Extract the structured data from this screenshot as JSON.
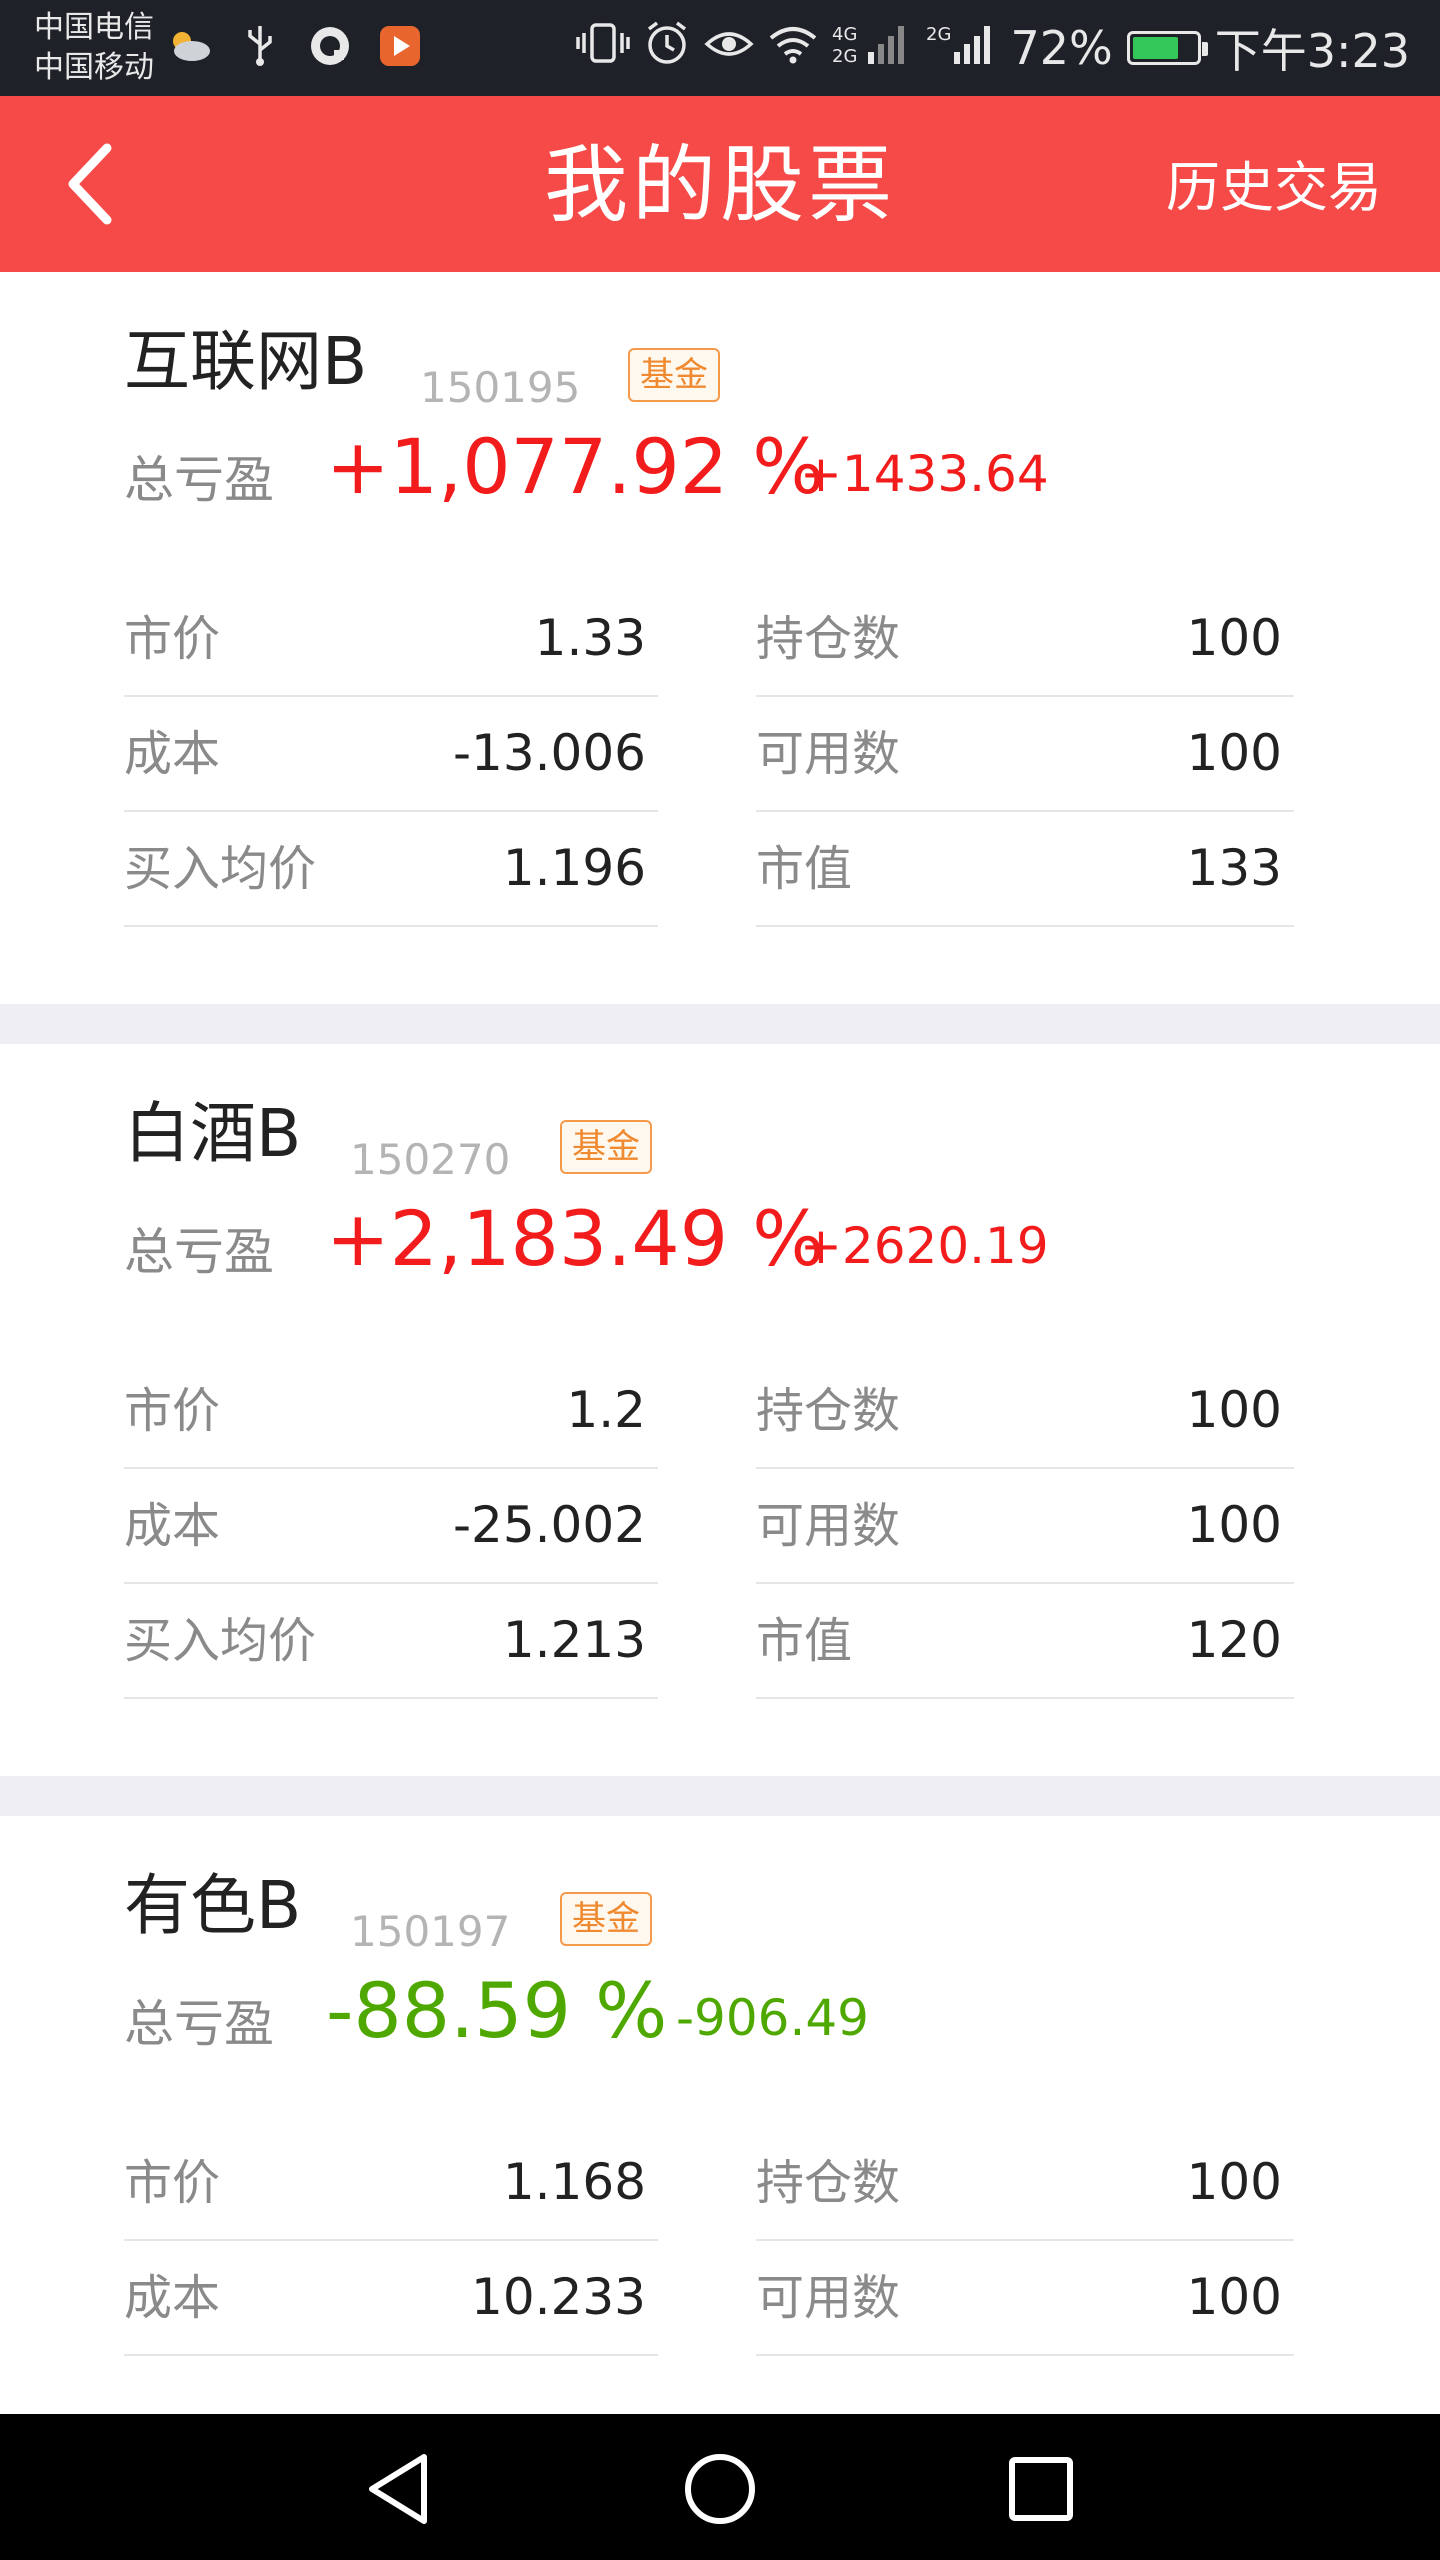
{
  "status_bar": {
    "carrier_1": "中国电信",
    "carrier_2": "中国移动",
    "battery_percent": "72%",
    "battery_level": 0.72,
    "time": "下午3:23",
    "icons": [
      "cloud-icon",
      "usb-icon",
      "qq-icon",
      "play-app-icon",
      "vibrate-icon",
      "alarm-icon",
      "eye-icon",
      "wifi-icon",
      "signal-4g-icon",
      "signal-2g-icon",
      "battery-icon"
    ]
  },
  "header": {
    "title": "我的股票",
    "history_label": "历史交易",
    "background_color": "#f64a49"
  },
  "labels": {
    "total_pl": "总亏盈",
    "market_price": "市价",
    "cost": "成本",
    "avg_buy_price": "买入均价",
    "position": "持仓数",
    "available": "可用数",
    "market_value": "市值"
  },
  "stocks": [
    {
      "name": "互联网B",
      "code": "150195",
      "tag": "基金",
      "pl_percent": "+1,077.92 %",
      "pl_amount": "+1433.64",
      "trend": "up",
      "market_price": "1.33",
      "cost": "-13.006",
      "avg_buy_price": "1.196",
      "position": "100",
      "available": "100",
      "market_value": "133"
    },
    {
      "name": "白酒B",
      "code": "150270",
      "tag": "基金",
      "pl_percent": "+2,183.49 %",
      "pl_amount": "+2620.19",
      "trend": "up",
      "market_price": "1.2",
      "cost": "-25.002",
      "avg_buy_price": "1.213",
      "position": "100",
      "available": "100",
      "market_value": "120"
    },
    {
      "name": "有色B",
      "code": "150197",
      "tag": "基金",
      "pl_percent": "-88.59 %",
      "pl_amount": "-906.49",
      "trend": "down",
      "market_price": "1.168",
      "cost": "10.233",
      "position": "100",
      "available": "100"
    }
  ],
  "colors": {
    "up": "#f21c1c",
    "down": "#4fa800",
    "tag": "#f08a30"
  },
  "nav_bar": {
    "icons": [
      "back-triangle-icon",
      "home-circle-icon",
      "recents-square-icon"
    ]
  }
}
